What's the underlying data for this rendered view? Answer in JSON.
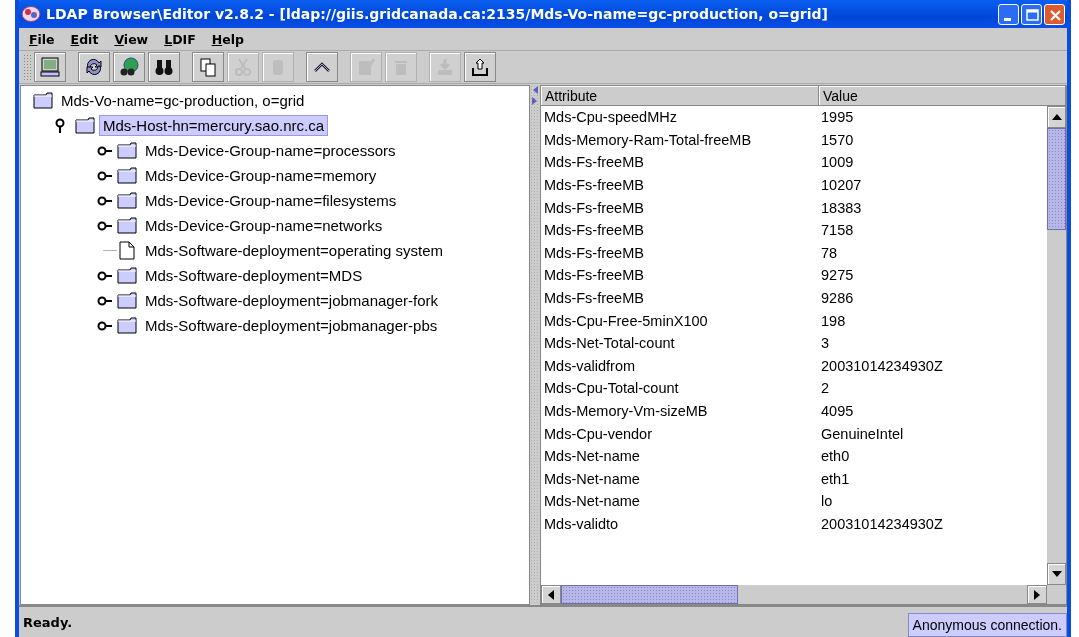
{
  "window": {
    "title": "LDAP Browser\\Editor v2.8.2 - [ldap://giis.gridcanada.ca:2135/Mds-Vo-name=gc-production, o=grid]"
  },
  "menu": [
    "File",
    "Edit",
    "View",
    "LDIF",
    "Help"
  ],
  "toolbar": [
    {
      "disabled": false
    },
    {
      "disabled": false
    },
    {
      "disabled": false
    },
    {
      "disabled": false
    },
    {
      "disabled": false
    },
    {
      "disabled": true
    },
    {
      "disabled": true
    },
    {
      "disabled": false
    },
    {
      "disabled": true
    },
    {
      "disabled": true
    },
    {
      "disabled": true
    },
    {
      "disabled": false
    }
  ],
  "tree": [
    {
      "label": "Mds-Vo-name=gc-production, o=grid",
      "kind": "folder",
      "selected": false,
      "children": [
        {
          "label": "Mds-Host-hn=mercury.sao.nrc.ca",
          "kind": "folder",
          "selected": true,
          "expanded": true,
          "children": [
            {
              "label": "Mds-Device-Group-name=processors",
              "kind": "folder",
              "selected": false,
              "expanded": false
            },
            {
              "label": "Mds-Device-Group-name=memory",
              "kind": "folder",
              "selected": false,
              "expanded": false
            },
            {
              "label": "Mds-Device-Group-name=filesystems",
              "kind": "folder",
              "selected": false,
              "expanded": false
            },
            {
              "label": "Mds-Device-Group-name=networks",
              "kind": "folder",
              "selected": false,
              "expanded": false
            },
            {
              "label": "Mds-Software-deployment=operating system",
              "kind": "leaf",
              "selected": false,
              "expanded": false
            },
            {
              "label": "Mds-Software-deployment=MDS",
              "kind": "folder",
              "selected": false,
              "expanded": false
            },
            {
              "label": "Mds-Software-deployment=jobmanager-fork",
              "kind": "folder",
              "selected": false,
              "expanded": false
            },
            {
              "label": "Mds-Software-deployment=jobmanager-pbs",
              "kind": "folder",
              "selected": false,
              "expanded": false
            }
          ]
        }
      ]
    }
  ],
  "table": {
    "columns": [
      "Attribute",
      "Value"
    ],
    "rows": [
      [
        "Mds-Cpu-speedMHz",
        "1995"
      ],
      [
        "Mds-Memory-Ram-Total-freeMB",
        "1570"
      ],
      [
        "Mds-Fs-freeMB",
        "1009"
      ],
      [
        "Mds-Fs-freeMB",
        "10207"
      ],
      [
        "Mds-Fs-freeMB",
        "18383"
      ],
      [
        "Mds-Fs-freeMB",
        "7158"
      ],
      [
        "Mds-Fs-freeMB",
        "78"
      ],
      [
        "Mds-Fs-freeMB",
        "9275"
      ],
      [
        "Mds-Fs-freeMB",
        "9286"
      ],
      [
        "Mds-Cpu-Free-5minX100",
        "198"
      ],
      [
        "Mds-Net-Total-count",
        "3"
      ],
      [
        "Mds-validfrom",
        "20031014234930Z"
      ],
      [
        "Mds-Cpu-Total-count",
        "2"
      ],
      [
        "Mds-Memory-Vm-sizeMB",
        "4095"
      ],
      [
        "Mds-Cpu-vendor",
        "GenuineIntel"
      ],
      [
        "Mds-Net-name",
        "eth0"
      ],
      [
        "Mds-Net-name",
        "eth1"
      ],
      [
        "Mds-Net-name",
        "lo"
      ],
      [
        "Mds-validto",
        "20031014234930Z"
      ]
    ]
  },
  "status_bar": {
    "message": "Ready.",
    "connection": "Anonymous connection."
  }
}
